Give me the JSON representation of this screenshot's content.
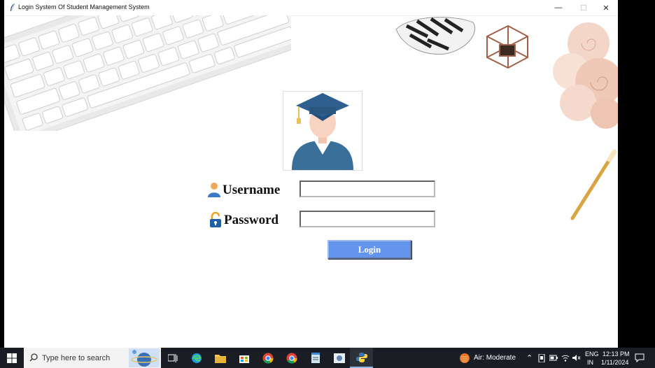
{
  "window": {
    "title": "Login System Of Student Management System",
    "controls": {
      "minimize": "—",
      "maximize": "☐",
      "close": "✕"
    }
  },
  "form": {
    "username_label": "Username",
    "password_label": "Password",
    "username_value": "",
    "password_value": "",
    "login_button": "Login"
  },
  "taskbar": {
    "search_placeholder": "Type here to search",
    "weather": "Air: Moderate",
    "language_top": "ENG",
    "language_bottom": "IN",
    "time": "12:13 PM",
    "date": "1/11/2024",
    "apps": [
      "task-view",
      "edge",
      "file-explorer",
      "store",
      "chrome",
      "chrome",
      "notepad",
      "photo-app",
      "python"
    ]
  },
  "colors": {
    "login_button": "#6495ed",
    "taskbar": "#1a1d24",
    "avatar_cap": "#2f5f8f",
    "avatar_gown": "#3a6f9a"
  }
}
